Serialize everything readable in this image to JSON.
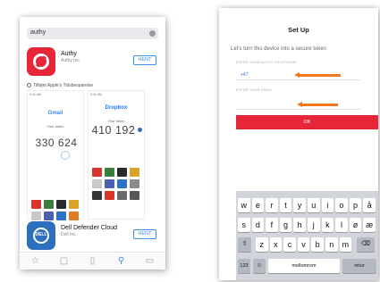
{
  "left_screen": {
    "search": {
      "query": "authy"
    },
    "authy_app": {
      "name": "Authy",
      "developer": "Authy Inc.",
      "get_label": "HENT"
    },
    "tested_note": "Tilføjet Apple's Tidsbesparelse",
    "screenshot_a": {
      "brand": "Gmail",
      "token": "330 624",
      "status": "9:41 AM",
      "token_label": "Your token"
    },
    "screenshot_b": {
      "brand": "Dropbox",
      "token": "410 192",
      "status": "9:41 AM",
      "token_label": "Your token"
    },
    "dell_app": {
      "name": "Dell Defender Cloud",
      "developer": "Dell Inc.",
      "get_label": "HENT",
      "icon_text": "DELL"
    },
    "tab_icons": [
      "featured-icon",
      "top-charts-icon",
      "categories-icon",
      "search-icon",
      "updates-icon"
    ],
    "tile_colors_a": [
      "#d9362b",
      "#3b7d3a",
      "#2a2a2a",
      "#d9a228",
      "#c9c9c9",
      "#4a5fb0",
      "#2b72c8",
      "#e07b26"
    ],
    "tile_colors_b": [
      "#d9362b",
      "#3b7d3a",
      "#2a2a2a",
      "#d9a228",
      "#c9c9c9",
      "#4a5fb0",
      "#2b72c8",
      "#8a8a8a",
      "#333333",
      "#d9362b",
      "#6a6a6a",
      "#555555"
    ]
  },
  "right_screen": {
    "title": "Set Up",
    "intro": "Let's turn this device into a secure token",
    "phone_label": "ENTER YOUR AUTHY CELLPHONE",
    "country_code": "+47",
    "email_label": "ENTER YOUR EMAIL",
    "ok_label": "OK",
    "arrow_color": "#f0781e",
    "accent_color": "#e8263a",
    "keyboard": {
      "row1": [
        "w",
        "e",
        "r",
        "t",
        "y",
        "u",
        "i",
        "o",
        "p",
        "å"
      ],
      "row2": [
        "s",
        "d",
        "f",
        "g",
        "h",
        "j",
        "k",
        "l",
        "ø",
        "æ"
      ],
      "row3": [
        "z",
        "x",
        "c",
        "v",
        "b",
        "n",
        "m"
      ],
      "space": "mellomrom",
      "return": "retur"
    }
  }
}
